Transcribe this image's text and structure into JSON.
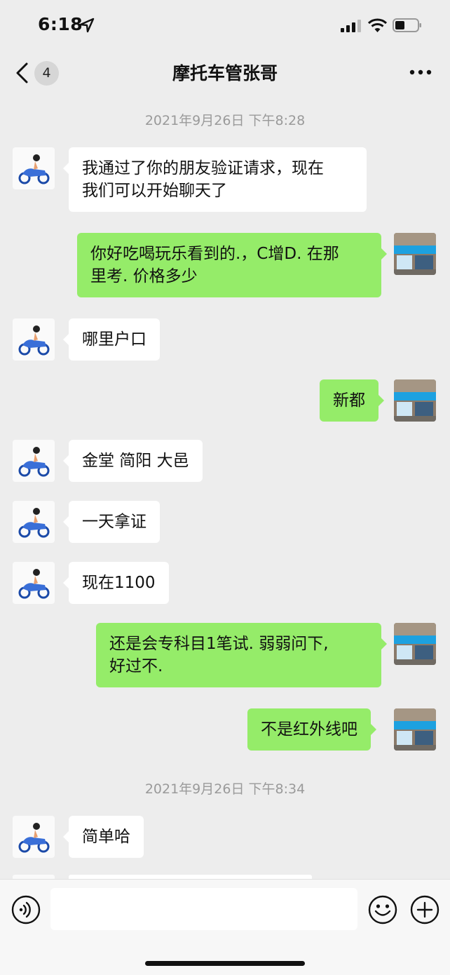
{
  "status_bar": {
    "time": "6:18"
  },
  "nav": {
    "badge": "4",
    "title": "摩托车管张哥"
  },
  "timestamps": [
    "2021年9月26日 下午8:28",
    "2021年9月26日 下午8:34"
  ],
  "messages": [
    {
      "from": "contact",
      "text": "我通过了你的朋友验证请求，现在\n我们可以开始聊天了"
    },
    {
      "from": "me",
      "text": "你好吃喝玩乐看到的.，C增D. 在那\n里考. 价格多少"
    },
    {
      "from": "contact",
      "text": "哪里户口"
    },
    {
      "from": "me",
      "text": "新都"
    },
    {
      "from": "contact",
      "text": "金堂 简阳 大邑"
    },
    {
      "from": "contact",
      "text": "一天拿证"
    },
    {
      "from": "contact",
      "text": "现在1100"
    },
    {
      "from": "me",
      "text": "还是会专科目1笔试. 弱弱问下,\n好过不."
    },
    {
      "from": "me",
      "text": "不是红外线吧"
    },
    {
      "from": "contact",
      "text": "简单哈"
    }
  ],
  "input": {
    "placeholder": ""
  },
  "colors": {
    "background": "#ededed",
    "my_bubble": "#95ec69",
    "their_bubble": "#ffffff"
  },
  "icons": [
    "location-arrow-icon",
    "signal-icon",
    "wifi-icon",
    "battery-icon",
    "back-chevron-icon",
    "more-dots-icon",
    "voice-icon",
    "emoji-icon",
    "plus-icon",
    "motorcycle-avatar",
    "storefront-avatar"
  ]
}
